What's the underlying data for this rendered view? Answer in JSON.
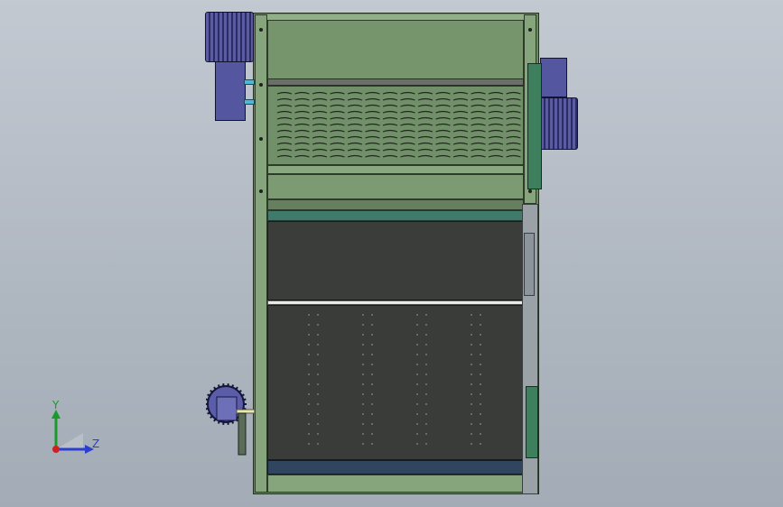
{
  "triad": {
    "y_label": "Y",
    "z_label": "Z",
    "y_color": "#1a9a2a",
    "z_color": "#2a3fd0",
    "x_color": "#d02020"
  },
  "colors": {
    "frame_green": "#6b8a63",
    "motor_blue": "#4b4c8f",
    "belt_dark": "#3b3d3b",
    "background": "#b4bbc4"
  },
  "icons": {
    "triad": "coordinate-axes-icon"
  }
}
